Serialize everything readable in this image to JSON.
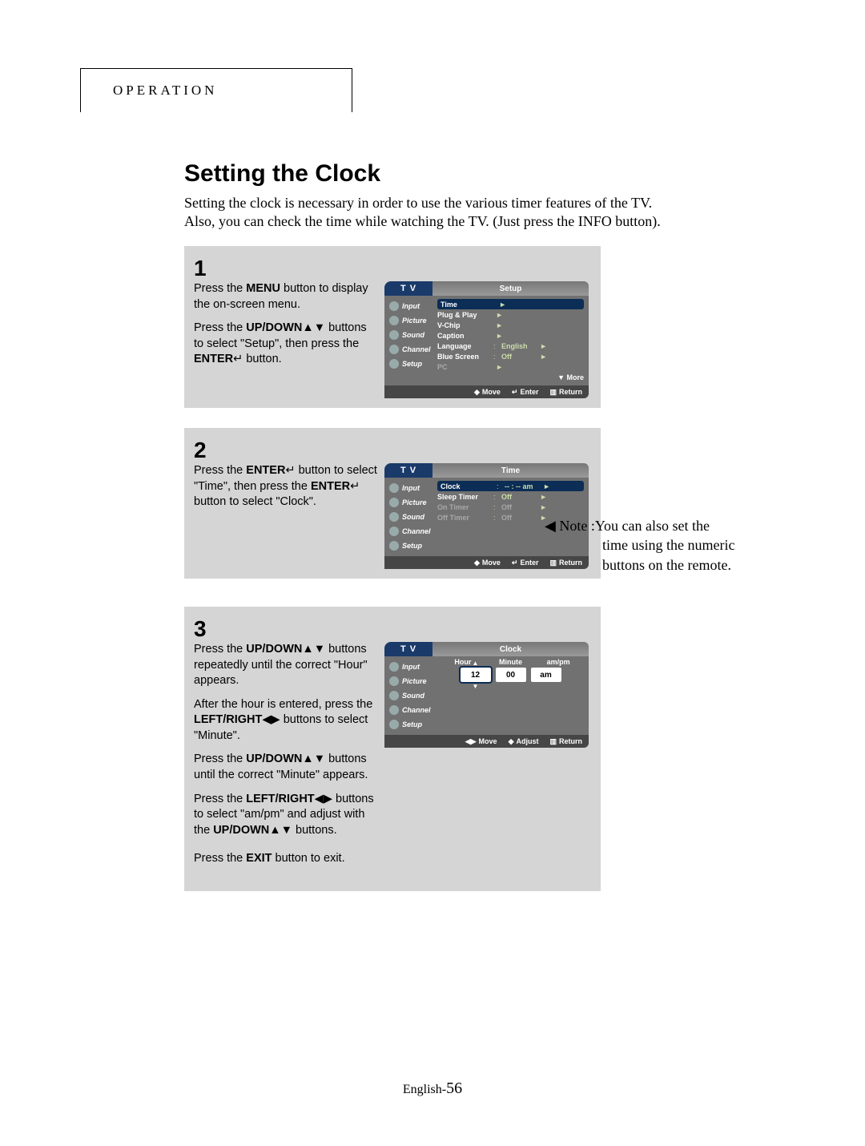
{
  "header": {
    "section": "OPERATION"
  },
  "title": "Setting the Clock",
  "intro_line1": "Setting the clock is  necessary in order to use the various timer features of the TV.",
  "intro_line2": "Also, you can check the time while watching the TV. (Just press the INFO button).",
  "side_labels": {
    "input": "Input",
    "picture": "Picture",
    "sound": "Sound",
    "channel": "Channel",
    "setup": "Setup"
  },
  "footer_labels": {
    "move": "Move",
    "enter": "Enter",
    "return": "Return",
    "adjust": "Adjust"
  },
  "step1": {
    "num": "1",
    "p1a": "Press the ",
    "p1b": "MENU",
    "p1c": " button to display the on-screen menu.",
    "p2a": "Press the ",
    "p2b": "UP/DOWN",
    "p2c": " buttons to select \"Setup\", then press the ",
    "p2d": "ENTER",
    "p2e": " button.",
    "osd": {
      "tv": "T V",
      "title": "Setup",
      "rows": [
        {
          "lbl": "Time",
          "val": "",
          "arr": "►",
          "sel": true
        },
        {
          "lbl": "Plug & Play",
          "val": "",
          "arr": "►"
        },
        {
          "lbl": "V-Chip",
          "val": "",
          "arr": "►"
        },
        {
          "lbl": "Caption",
          "val": "",
          "arr": "►"
        },
        {
          "lbl": "Language",
          "val": "English",
          "arr": "►"
        },
        {
          "lbl": "Blue Screen",
          "val": "Off",
          "arr": "►"
        },
        {
          "lbl": "PC",
          "val": "",
          "arr": "►",
          "dim": true
        }
      ],
      "more": "▼  More"
    }
  },
  "step2": {
    "num": "2",
    "p1a": "Press the ",
    "p1b": "ENTER",
    "p1c": " button to select \"Time\", then press the ",
    "p1d": "ENTER",
    "p1e": " button to select \"Clock\".",
    "osd": {
      "tv": "T V",
      "title": "Time",
      "rows": [
        {
          "lbl": "Clock",
          "val": "-- : --   am",
          "arr": "►",
          "sel": true
        },
        {
          "lbl": "Sleep Timer",
          "val": "Off",
          "arr": "►"
        },
        {
          "lbl": "On Timer",
          "val": "Off",
          "arr": "►",
          "dim": true
        },
        {
          "lbl": "Off Timer",
          "val": "Off",
          "arr": "►",
          "dim": true
        }
      ]
    }
  },
  "step3": {
    "num": "3",
    "p1a": "Press the ",
    "p1b": "UP/DOWN",
    "p1c": " buttons repeatedly until the correct \"Hour\" appears.",
    "p2a": "After the hour is entered, press the ",
    "p2b": "LEFT/RIGHT",
    "p2c": " buttons to select \"Minute\".",
    "p3a": "Press the ",
    "p3b": "UP/DOWN",
    "p3c": " buttons until the correct \"Minute\" appears.",
    "p4a": "Press the ",
    "p4b": "LEFT/RIGHT",
    "p4c": " buttons to select \"am/pm\" and adjust with the ",
    "p4d": "UP/DOWN",
    "p4e": "   buttons.",
    "p5a": "Press the ",
    "p5b": "EXIT",
    "p5c": " button to exit.",
    "osd": {
      "tv": "T V",
      "title": "Clock",
      "headers": {
        "hour": "Hour",
        "minute": "Minute",
        "ampm": "am/pm"
      },
      "values": {
        "hour": "12",
        "minute": "00",
        "ampm": "am"
      }
    }
  },
  "note": {
    "prefix": "◀  Note :",
    "l1": "You can also set the",
    "l2": "time using the numeric",
    "l3": "buttons on the remote."
  },
  "page_footer": {
    "lang": "English-",
    "num": "56"
  },
  "glyphs": {
    "updown": "▲▼",
    "leftright": "◀▶",
    "enter": "↵",
    "move_v": "◆",
    "move_h": "◀▶",
    "return": "▥"
  }
}
